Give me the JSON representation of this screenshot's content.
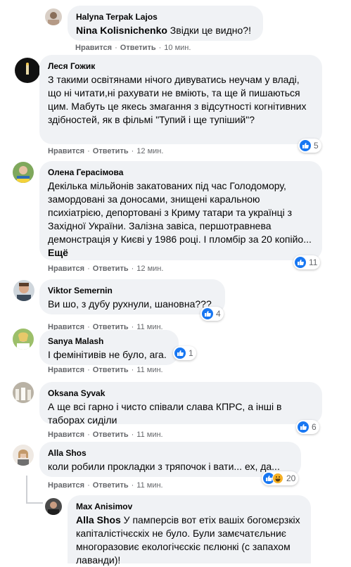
{
  "comments": [
    {
      "author": "Halyna Terpak Lajos",
      "mention": "Nina Kolisnichenko",
      "text": " Звідки це видно?!",
      "like": "Нравится",
      "reply": "Ответить",
      "time": "10 мин."
    },
    {
      "author": "Леся Гожик",
      "text": "З такими освітянами нічого дивуватись неучам у владі, що ні читати,ні рахувати не вміють, та ще й пишаються цим. Мабуть це якесь змагання з відсутності когнітивних здібностей, як в фільмі \"Тупий і ще тупіший\"?",
      "like": "Нравится",
      "reply": "Ответить",
      "time": "12 мин.",
      "reactions": "5"
    },
    {
      "author": "Олена Герасімова",
      "text": "Декілька мільйонів закатованих під час Голодомору, замордовані за доносами, знищені каральною психіатрією, депортовані з Криму татари та українці з Західної України. Залізна завіса, першотравнева демонстрація у Києві у 1986 році. І пломбір за 20 копійо...",
      "more": "Ещё",
      "like": "Нравится",
      "reply": "Ответить",
      "time": "12 мин.",
      "reactions": "11"
    },
    {
      "author": "Viktor Semernin",
      "text": "Ви шо, з дубу рухнули, шановна???",
      "like": "Нравится",
      "reply": "Ответить",
      "time": "11 мин.",
      "reactions": "4"
    },
    {
      "author": "Sanya Malash",
      "text": "І фемінітивів не було, ага.",
      "like": "Нравится",
      "reply": "Ответить",
      "time": "11 мин.",
      "reactions": "1"
    },
    {
      "author": "Oksana Syvak",
      "text": "А ще всі гарно і чисто співали слава КПРС, а інші в таборах сиділи",
      "like": "Нравится",
      "reply": "Ответить",
      "time": "11 мин.",
      "reactions": "6"
    },
    {
      "author": "Alla Shos",
      "text": "коли робили прокладки з тряпочок і вати... ех, да...",
      "like": "Нравится",
      "reply": "Ответить",
      "time": "11 мин.",
      "reactions": "20"
    },
    {
      "author": "Max Anisimov",
      "mention": "Alla Shos",
      "text": " У памперсів вот етіх вашіх богомєрзкіх капіталістічєскіх не було. Були замєчатєльниє многоразовиє екологічєскіє пєлюнкі (с запахом лаванди)!"
    }
  ],
  "colors": {
    "bubble": "#f0f2f5",
    "like_blue": "#1877f2",
    "meta": "#65676b"
  }
}
